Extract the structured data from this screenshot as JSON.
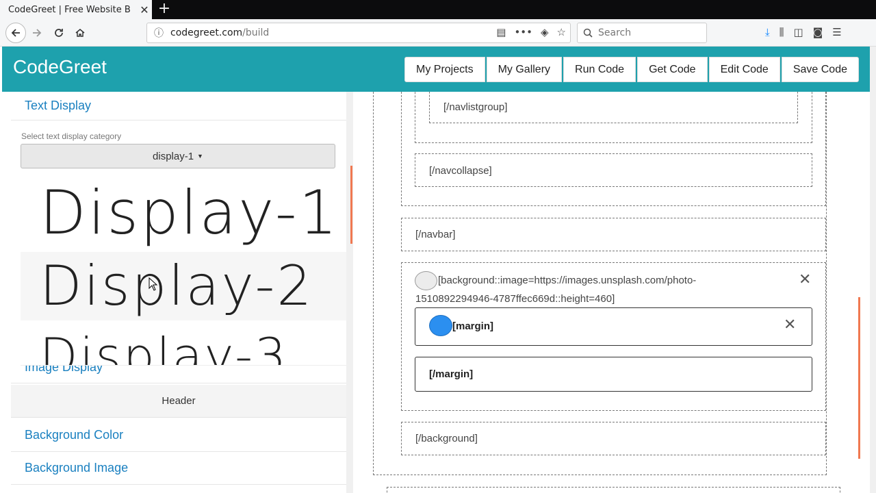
{
  "browser": {
    "tab_title": "CodeGreet | Free Website B",
    "tab_close": "✕",
    "new_tab": "+",
    "url_host": "codegreet.com",
    "url_path": "/build",
    "search_placeholder": "Search"
  },
  "app": {
    "brand": "CodeGreet",
    "buttons": [
      "My Projects",
      "My Gallery",
      "Run Code",
      "Get Code",
      "Edit Code",
      "Save Code"
    ]
  },
  "left_panel": {
    "text_display": "Text Display",
    "select_label": "Select text display category",
    "selected": "display-1",
    "options": [
      "Display-1",
      "Display-2",
      "Display-3"
    ],
    "image_display": "Image Display",
    "header": "Header",
    "background_color": "Background Color",
    "background_image": "Background Image"
  },
  "canvas": {
    "navlistgroup_close": "[/navlistgroup]",
    "navcollapse_close": "[/navcollapse]",
    "navbar_close": "[/navbar]",
    "background_open_line1": "[background::image=https://images.unsplash.com/photo-",
    "background_open_line2": "1510892294946-4787ffec669d::height=460]",
    "margin_open": "[margin]",
    "margin_close": "[/margin]",
    "background_close": "[/background]",
    "close_symbol": "✕"
  },
  "colors": {
    "header_bg": "#1ea1ad",
    "link": "#1a80c0",
    "accent_circle": "#2b8ff0"
  }
}
